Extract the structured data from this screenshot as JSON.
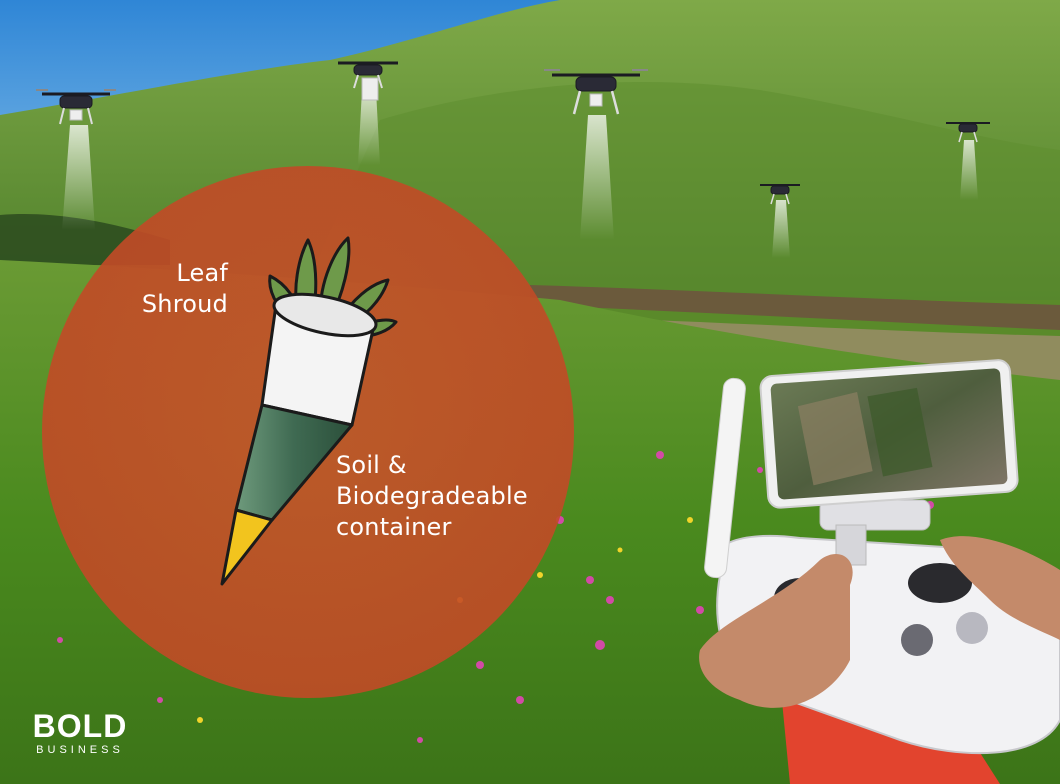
{
  "labels": {
    "leaf_shroud_line1": "Leaf",
    "leaf_shroud_line2": "Shroud",
    "soil_line1": "Soil &",
    "soil_line2": "Biodegradeable",
    "soil_line3": "container"
  },
  "logo": {
    "word": "BOLD",
    "sub": "BUSINESS"
  },
  "colors": {
    "sky": "#3a8fd8",
    "hill": "#6e9a3c",
    "meadow": "#4f8a22",
    "circle_overlay": "#c8502a",
    "pod_body": "#ffffff",
    "pod_cone": "#3f6a52",
    "pod_tip": "#f2c41e",
    "controller_jacket": "#e2442e"
  }
}
